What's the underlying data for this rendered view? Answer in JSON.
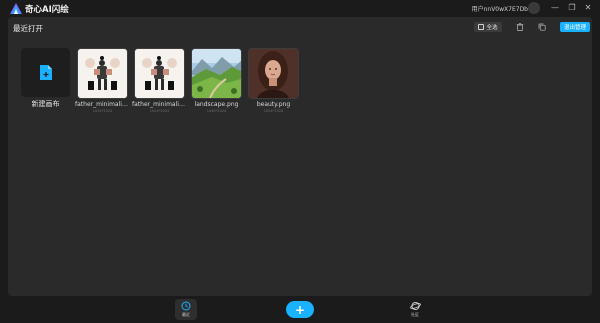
{
  "app": {
    "title": "奇心AI闪绘",
    "user": "用户nnV0wX7E7Db"
  },
  "window": {
    "minimize_icon": "minimize-icon",
    "restore_icon": "restore-icon",
    "close_icon": "close-icon"
  },
  "toolbar": {
    "page_title": "最近打开",
    "select_all_label": "全选",
    "exit_manage_label": "退出管理"
  },
  "items": [
    {
      "label": "新建画布",
      "meta": "",
      "kind": "new"
    },
    {
      "label": "father_minimalist_s...",
      "meta": "1024*1024",
      "kind": "image"
    },
    {
      "label": "father_minimalist_s...",
      "meta": "1024*1024",
      "kind": "image"
    },
    {
      "label": "landscape.png",
      "meta": "1440*1024",
      "kind": "image"
    },
    {
      "label": "beauty.png",
      "meta": "1024*1024",
      "kind": "image"
    }
  ],
  "bottom_nav": {
    "recent_label": "最近",
    "add_label": "+",
    "community_label": "社区"
  },
  "colors": {
    "accent": "#1ab2ff",
    "panel": "#2a2a2a",
    "background": "#1b1b1b"
  }
}
